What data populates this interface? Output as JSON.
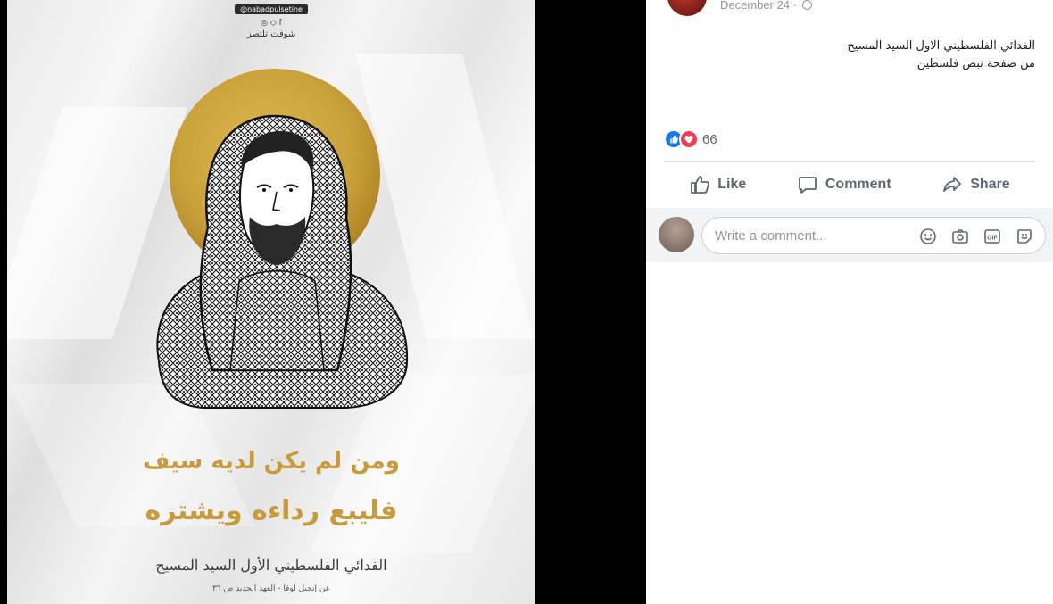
{
  "poster": {
    "handle": "@nabadpulsetine",
    "social_icons": "◎ ◇ f",
    "brand": "شوفت تلتصز",
    "headline_line1": "ومن لم يكن لديه سيف",
    "headline_line2": "فليبع رداءه ويشتره",
    "caption_line1": "الفدائي الفلسطيني الأول السيد المسيح",
    "caption_line2": "عن إنجيل لوقا - العهد الجديد ص ٣٦",
    "halo_color": "#c9a13a",
    "text_gold": "#c79a3b"
  },
  "post": {
    "date": "December 24 ·",
    "text_line1": "الفدائي الفلسطيني الاول السيد المسيح",
    "text_line2": "من صفحة نبض فلسطين",
    "reaction_count": "66",
    "actions": {
      "like": "Like",
      "comment": "Comment",
      "share": "Share"
    },
    "comment_placeholder": "Write a comment..."
  }
}
